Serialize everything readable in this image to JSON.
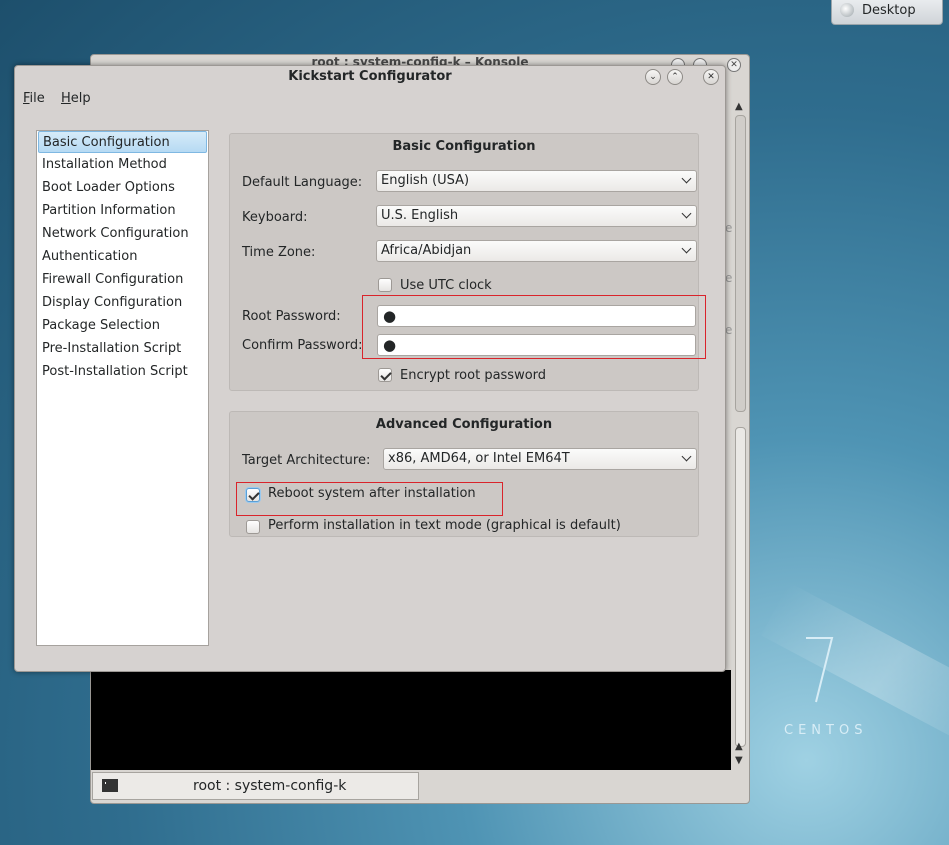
{
  "desktop": {
    "desktop_button_label": "Desktop",
    "centos_version": "7",
    "centos_word": "CENTOS"
  },
  "konsole": {
    "title": "root : system-config-k – Konsole",
    "tab_label": "root : system-config-k",
    "partial_letters": [
      "e",
      "e",
      "e"
    ]
  },
  "kickstart": {
    "title": "Kickstart Configurator",
    "menu": {
      "file_prefix": "F",
      "file_rest": "ile",
      "help_prefix": "H",
      "help_rest": "elp"
    },
    "sidebar": {
      "selected_index": 0,
      "items": [
        {
          "label": "Basic Configuration"
        },
        {
          "label": "Installation Method"
        },
        {
          "label": "Boot Loader Options"
        },
        {
          "label": "Partition Information"
        },
        {
          "label": "Network Configuration"
        },
        {
          "label": "Authentication"
        },
        {
          "label": "Firewall Configuration"
        },
        {
          "label": "Display Configuration"
        },
        {
          "label": "Package Selection"
        },
        {
          "label": "Pre-Installation Script"
        },
        {
          "label": "Post-Installation Script"
        }
      ]
    },
    "basic": {
      "heading": "Basic Configuration",
      "default_language_label": "Default Language:",
      "default_language_value": "English (USA)",
      "keyboard_label": "Keyboard:",
      "keyboard_value": "U.S. English",
      "time_zone_label": "Time Zone:",
      "time_zone_value": "Africa/Abidjan",
      "utc_label": "Use UTC clock",
      "utc_checked": false,
      "root_password_label": "Root Password:",
      "root_password_value": "●",
      "confirm_password_label": "Confirm Password:",
      "confirm_password_value": "●",
      "encrypt_label": "Encrypt root password",
      "encrypt_checked": true
    },
    "advanced": {
      "heading": "Advanced Configuration",
      "target_arch_label": "Target Architecture:",
      "target_arch_value": "x86, AMD64, or Intel EM64T",
      "reboot_label": "Reboot system after installation",
      "reboot_checked": true,
      "text_mode_label": "Perform installation in text mode (graphical is default)",
      "text_mode_checked": false
    }
  },
  "colors": {
    "highlight": "#d9242b",
    "selection": "#b6daf3",
    "window_bg": "#d6d2d0"
  }
}
